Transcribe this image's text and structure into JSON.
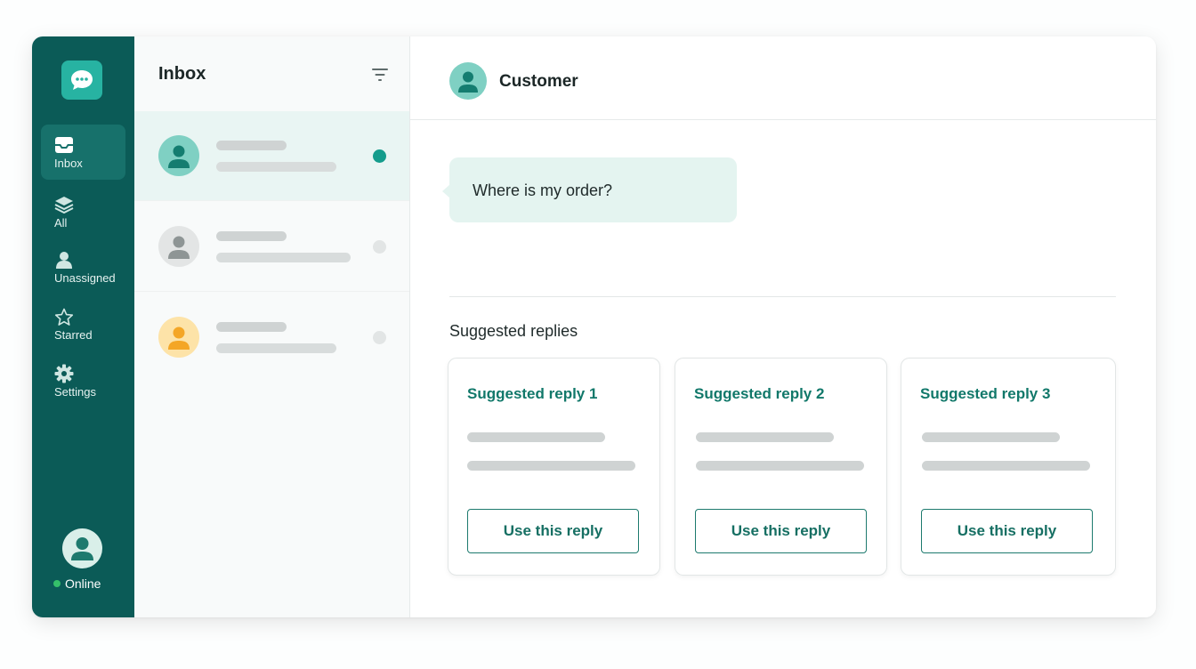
{
  "theme": {
    "rail_bg": "#0b5b57",
    "accent": "#11786a",
    "online": "#35c06a"
  },
  "nav": {
    "logo_icon": "chat-bubble-icon",
    "items": [
      {
        "label": "Inbox",
        "icon": "inbox-icon",
        "active": true
      },
      {
        "label": "All",
        "icon": "layers-icon",
        "active": false
      },
      {
        "label": "Unassigned",
        "icon": "person-icon",
        "active": false
      },
      {
        "label": "Starred",
        "icon": "star-icon",
        "active": false
      },
      {
        "label": "Settings",
        "icon": "gear-icon",
        "active": false
      }
    ],
    "user_status": "Online"
  },
  "inbox": {
    "title": "Inbox",
    "filter_icon": "filter-icon",
    "conversations": [
      {
        "avatar_color": "#7fd0c3",
        "unread": true
      },
      {
        "avatar_color": "#e3e5e5",
        "unread": false
      },
      {
        "avatar_color": "#fde3a8",
        "unread": false
      }
    ]
  },
  "conversation": {
    "customer_name": "Customer",
    "message": "Where is my order?"
  },
  "suggestions": {
    "heading": "Suggested replies",
    "cards": [
      {
        "title": "Suggested reply 1",
        "button": "Use this reply"
      },
      {
        "title": "Suggested reply 2",
        "button": "Use this reply"
      },
      {
        "title": "Suggested reply 3",
        "button": "Use this reply"
      }
    ]
  }
}
